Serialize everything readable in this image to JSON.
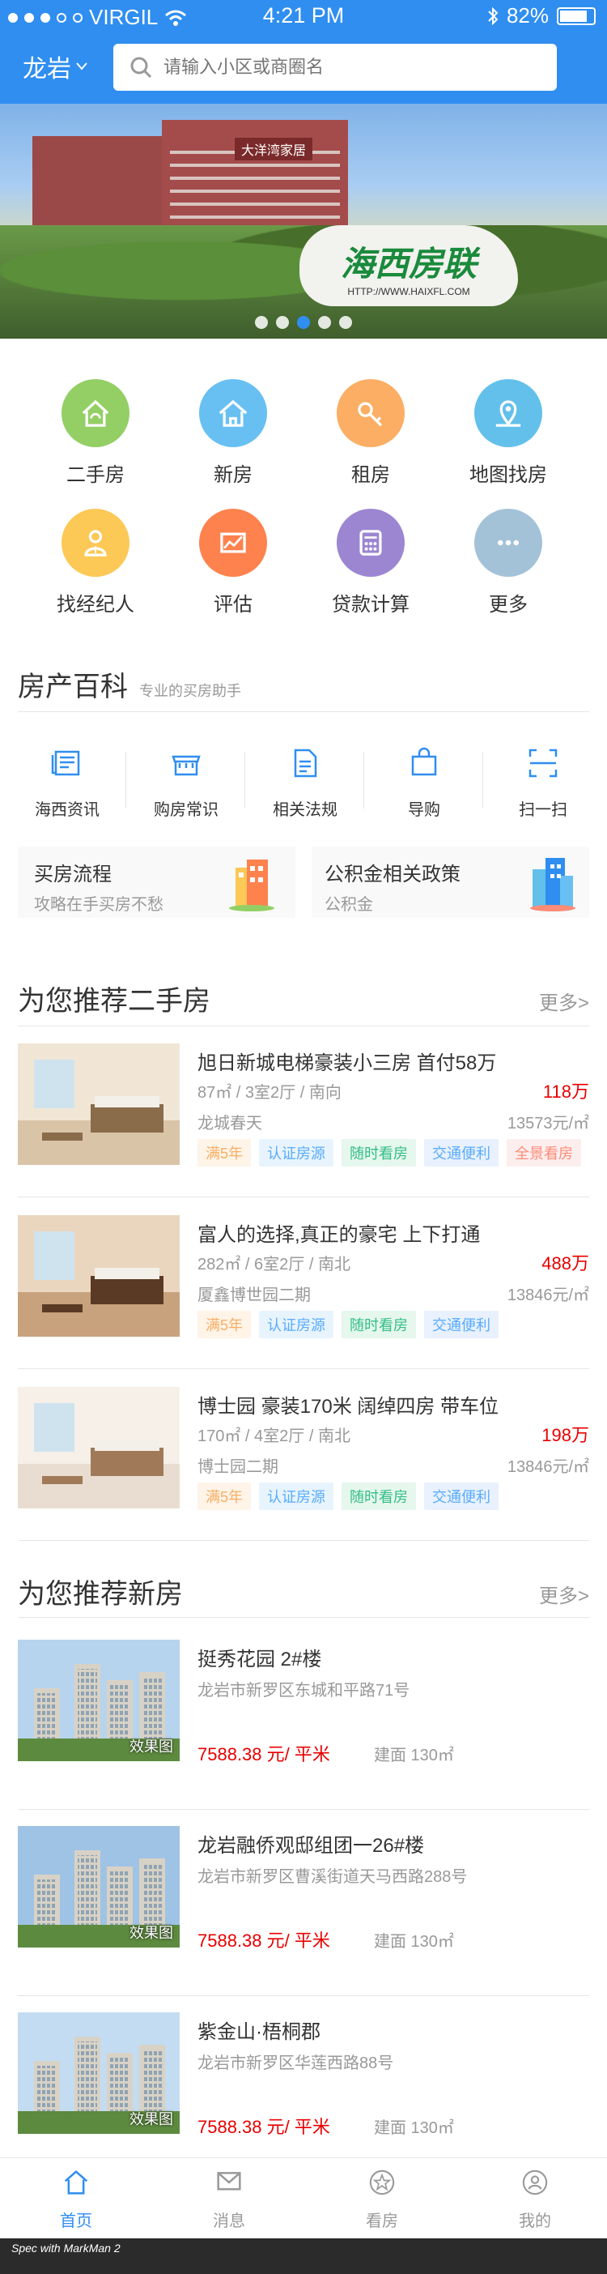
{
  "status_bar": {
    "carrier": "VIRGIL",
    "time": "4:21 PM",
    "battery": "82%"
  },
  "header": {
    "city": "龙岩",
    "search_placeholder": "请输入小区或商圈名"
  },
  "banner": {
    "logo_text": "海西房联",
    "logo_url": "HTTP://WWW.HAIXFL.COM",
    "building_sign": "大洋湾家居",
    "dots": 5,
    "active_dot": 3
  },
  "grid": [
    {
      "label": "二手房",
      "icon": "house-refresh-icon",
      "color": "#93cf64"
    },
    {
      "label": "新房",
      "icon": "house-icon",
      "color": "#68c0f2"
    },
    {
      "label": "租房",
      "icon": "key-icon",
      "color": "#fbae64"
    },
    {
      "label": "地图找房",
      "icon": "map-pin-icon",
      "color": "#63c0eb"
    },
    {
      "label": "找经纪人",
      "icon": "agent-icon",
      "color": "#fcc856"
    },
    {
      "label": "评估",
      "icon": "chart-envelope-icon",
      "color": "#fd824e"
    },
    {
      "label": "贷款计算",
      "icon": "calculator-icon",
      "color": "#9c86d2"
    },
    {
      "label": "更多",
      "icon": "more-dots-icon",
      "color": "#a3c2d8"
    }
  ],
  "encyclopedia": {
    "title": "房产百科",
    "subtitle": "专业的买房助手",
    "tools": [
      {
        "label": "海西资讯",
        "icon": "news-icon"
      },
      {
        "label": "购房常识",
        "icon": "shop-icon"
      },
      {
        "label": "相关法规",
        "icon": "document-icon"
      },
      {
        "label": "导购",
        "icon": "bag-icon"
      },
      {
        "label": "扫一扫",
        "icon": "scan-icon"
      }
    ],
    "cards": [
      {
        "title": "买房流程",
        "sub": "攻略在手买房不愁"
      },
      {
        "title": "公积金相关政策",
        "sub": "公积金"
      }
    ]
  },
  "second_hand": {
    "title": "为您推荐二手房",
    "more": "更多>",
    "items": [
      {
        "title": "旭日新城电梯豪装小三房 首付58万",
        "info": "87㎡ / 3室2厅 / 南向",
        "price": "118万",
        "community": "龙城春天",
        "unit": "13573元/㎡",
        "tags": [
          "满5年",
          "认证房源",
          "随时看房",
          "交通便利",
          "全景看房"
        ]
      },
      {
        "title": "富人的选择,真正的豪宅 上下打通",
        "info": "282㎡ / 6室2厅 / 南北",
        "price": "488万",
        "community": "厦鑫博世园二期",
        "unit": "13846元/㎡",
        "tags": [
          "满5年",
          "认证房源",
          "随时看房",
          "交通便利"
        ]
      },
      {
        "title": "博士园 豪装170米 阔绰四房 带车位",
        "info": "170㎡ / 4室2厅 / 南北",
        "price": "198万",
        "community": "博士园二期",
        "unit": "13846元/㎡",
        "tags": [
          "满5年",
          "认证房源",
          "随时看房",
          "交通便利"
        ]
      }
    ]
  },
  "new_house": {
    "title": "为您推荐新房",
    "more": "更多>",
    "items": [
      {
        "title": "挺秀花园 2#楼",
        "address": "龙岩市新罗区东城和平路71号",
        "price": "7588.38 元/ 平米",
        "area": "建面 130㎡",
        "badge": "效果图"
      },
      {
        "title": "龙岩融侨观邸组团一26#楼",
        "address": "龙岩市新罗区曹溪街道天马西路288号",
        "price": "7588.38 元/ 平米",
        "area": "建面 130㎡",
        "badge": "效果图"
      },
      {
        "title": "紫金山·梧桐郡",
        "address": "龙岩市新罗区华莲西路88号",
        "price": "7588.38 元/ 平米",
        "area": "建面 130㎡",
        "badge": "效果图"
      }
    ]
  },
  "tabbar": [
    {
      "label": "首页",
      "icon": "home-icon",
      "active": true
    },
    {
      "label": "消息",
      "icon": "message-icon",
      "active": false
    },
    {
      "label": "看房",
      "icon": "star-icon",
      "active": false
    },
    {
      "label": "我的",
      "icon": "user-icon",
      "active": false
    }
  ],
  "colors": {
    "primary": "#2f8ef0",
    "price": "#e80000",
    "text": "#333333",
    "muted": "#999999",
    "divider": "#e5e5e5"
  },
  "tag_colors": [
    {
      "bg": "#fef4e8",
      "fg": "#fbae64"
    },
    {
      "bg": "#e8f4fd",
      "fg": "#59abfd"
    },
    {
      "bg": "#e6f7ee",
      "fg": "#33be85"
    },
    {
      "bg": "#e8f1fd",
      "fg": "#59abfd"
    },
    {
      "bg": "#fdeeee",
      "fg": "#fb8c78"
    }
  ],
  "footer": "Spec with MarkMan 2"
}
